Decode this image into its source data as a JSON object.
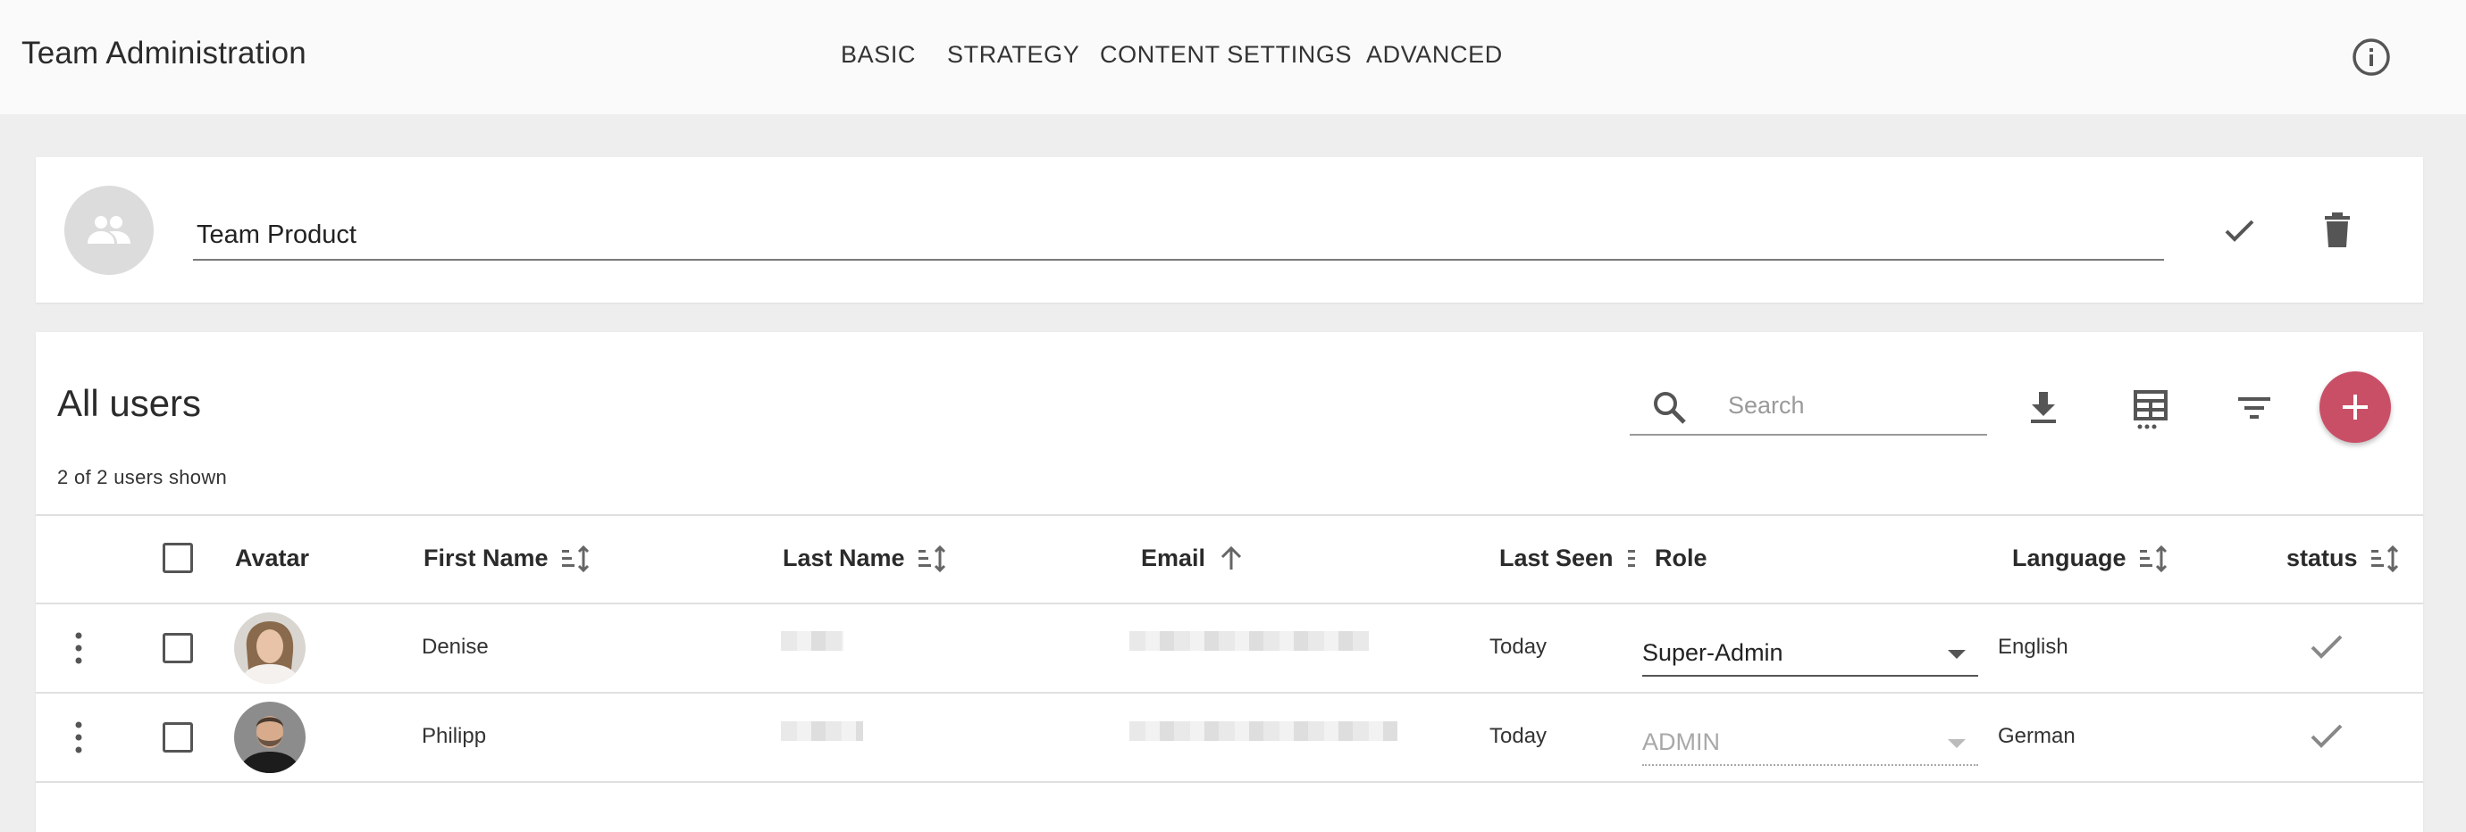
{
  "app": {
    "title": "Team Administration",
    "tabs": [
      "BASIC",
      "STRATEGY",
      "CONTENT SETTINGS",
      "ADVANCED"
    ]
  },
  "team": {
    "name": "Team Product"
  },
  "users": {
    "title": "All users",
    "count_text": "2 of 2 users shown",
    "search_placeholder": "Search",
    "columns": {
      "avatar": "Avatar",
      "first_name": "First Name",
      "last_name": "Last Name",
      "email": "Email",
      "last_seen": "Last Seen",
      "role": "Role",
      "language": "Language",
      "status": "status"
    },
    "rows": [
      {
        "first_name": "Denise",
        "last_seen": "Today",
        "role": "Super-Admin",
        "role_enabled": true,
        "language": "English"
      },
      {
        "first_name": "Philipp",
        "last_seen": "Today",
        "role": "ADMIN",
        "role_enabled": false,
        "language": "German"
      }
    ]
  },
  "colors": {
    "accent": "#c94f67",
    "appbar": "#fafafa",
    "background": "#eeeeee"
  },
  "icons": [
    "info-icon",
    "group-icon",
    "check-icon",
    "delete-icon",
    "search-icon",
    "download-icon",
    "table-columns-icon",
    "filter-icon",
    "add-icon",
    "sort-icon",
    "sort-ascending-icon",
    "more-vert-icon"
  ]
}
